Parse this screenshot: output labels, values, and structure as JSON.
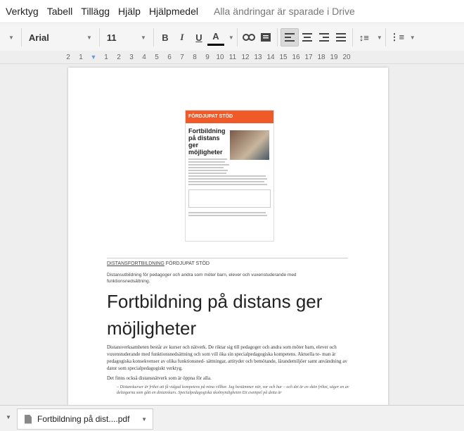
{
  "menu": {
    "items": [
      "Verktyg",
      "Tabell",
      "Tillägg",
      "Hjälp",
      "Hjälpmedel"
    ],
    "saved_status": "Alla ändringar är sparade i Drive"
  },
  "toolbar": {
    "font": "Arial",
    "size": "11"
  },
  "ruler": {
    "ticks": [
      "2",
      "1",
      "",
      "1",
      "2",
      "3",
      "4",
      "5",
      "6",
      "7",
      "8",
      "9",
      "10",
      "11",
      "12",
      "13",
      "14",
      "15",
      "16",
      "17",
      "18",
      "19",
      "20"
    ]
  },
  "document": {
    "thumb_header": "FÖRDJUPAT STÖD",
    "thumb_title": "Fortbildning på distans ger möjligheter",
    "kicker_link": "DISTANSFORTBILDNING",
    "kicker_rest": " FÖRDJUPAT STÖD",
    "lede": "Distansutbildning för pedagoger och andra som möter barn, elever och vuxenstuderande med funktionsnedsättning.",
    "title": "Fortbildning på distans ger möjligheter",
    "para1": "Distansverksamheten består av kurser och nätverk. De riktar sig till pedagoger och andra som möter barn, elever och vuxenstuderande med funktionsnedsättning och som vill öka sin specialpedagogiska kompetens. Aktuella te- man är pedagogiska konsekvenser av olika funktionsned- sättningar, attityder och bemötande, lärandemiljöer samt användning av dator som specialpedagogiskt verktyg.",
    "para2": "Det finns också distansnätverk som är öppna för alla.",
    "quote": "– Distanskurser är frihet att få vidgad kompetens på mina villkor. Jag bestämmer när, var och hur – och det är en skön frihet, säger en av deltagarna som gått en distanskurs. Specialpedagogiska skolmyndigheten Ett exempel på detta är"
  },
  "download": {
    "filename": "Fortbildning på dist....pdf"
  }
}
